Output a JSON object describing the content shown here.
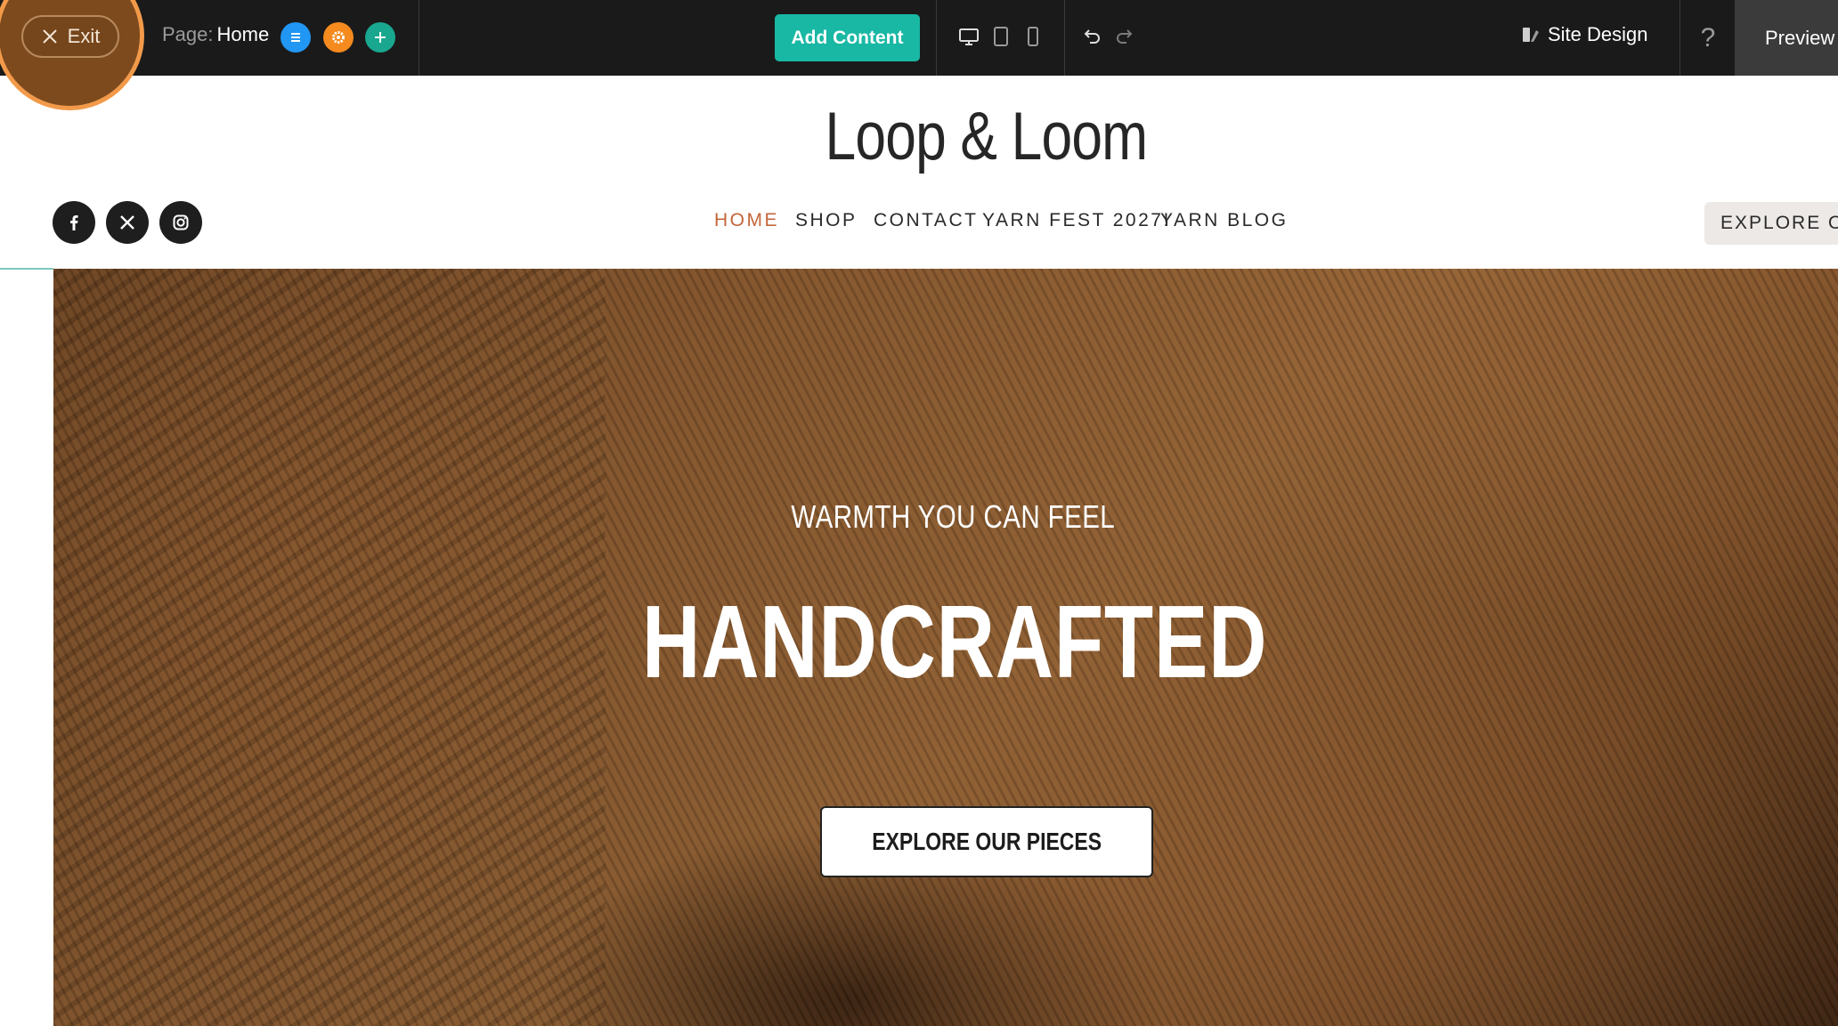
{
  "toolbar": {
    "exit_label": "Exit",
    "page_prefix": "Page:",
    "page_name": "Home",
    "add_content_label": "Add Content",
    "site_design_label": "Site Design",
    "help_label": "?",
    "preview_label": "Preview",
    "icons": [
      "close-icon",
      "page-list-icon",
      "page-settings-icon",
      "add-page-icon",
      "desktop-icon",
      "tablet-icon",
      "mobile-icon",
      "undo-icon",
      "redo-icon",
      "site-design-icon"
    ],
    "colors": {
      "background": "#1a1a1a",
      "accent": "#19b8a4",
      "exit_highlight": "#f29a4a"
    }
  },
  "site": {
    "brand": "Loop & Loom",
    "social": [
      "facebook-icon",
      "x-icon",
      "instagram-icon"
    ],
    "nav": [
      "HOME",
      "SHOP",
      "CONTACT",
      "YARN FEST 2027!",
      "YARN BLOG"
    ],
    "active_nav": "HOME",
    "header_cta": "EXPLORE OUR",
    "colors": {
      "active_nav": "#c4653a"
    }
  },
  "hero": {
    "eyebrow": "WARMTH YOU CAN FEEL",
    "title": "HANDCRAFTED",
    "cta": "EXPLORE OUR PIECES"
  }
}
